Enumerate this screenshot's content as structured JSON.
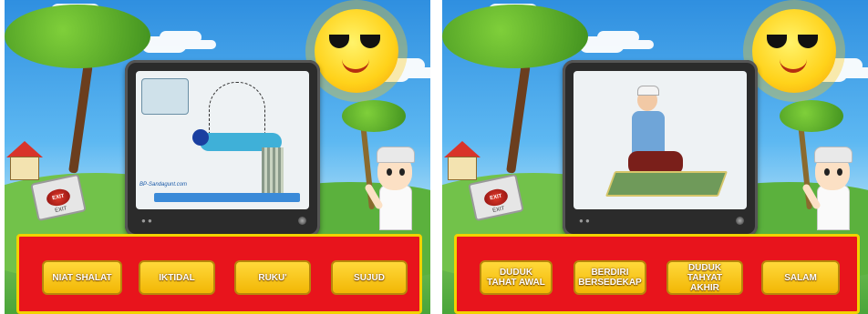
{
  "left_panel": {
    "exit_sign": {
      "button_label": "EXIT",
      "sub_label": "EXIT"
    },
    "screen_credit": "BP-Sandagunt.com",
    "options": [
      "NIAT SHALAT",
      "IKTIDAL",
      "RUKU'",
      "SUJUD"
    ]
  },
  "right_panel": {
    "exit_sign": {
      "button_label": "EXIT",
      "sub_label": "EXIT"
    },
    "options": [
      "DUDUK\nTAHAT AWAL",
      "BERDIRI\nBERSEDEKAP",
      "DUDUK\nTAHYAT AKHIR",
      "SALAM"
    ]
  },
  "colors": {
    "answer_bar": "#e8141c",
    "answer_bar_border": "#f2d200",
    "button": "#f7c51c"
  }
}
